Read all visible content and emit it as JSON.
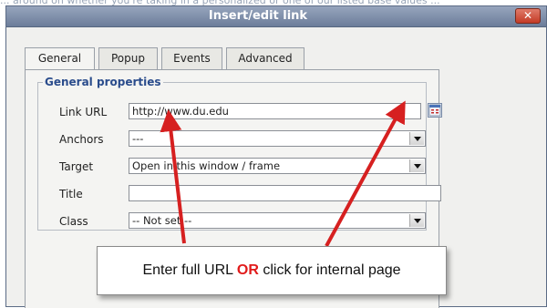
{
  "background": {
    "text": "... around on whether you're taking in a personalized or one of our listed base values ..."
  },
  "dialog": {
    "title": "Insert/edit link",
    "close_label": "✕",
    "tabs": [
      "General",
      "Popup",
      "Events",
      "Advanced"
    ],
    "active_tab": "General",
    "section_legend": "General properties",
    "fields": {
      "link_url": {
        "label": "Link URL",
        "value": "http://www.du.edu"
      },
      "anchors": {
        "label": "Anchors",
        "value": "---"
      },
      "target": {
        "label": "Target",
        "value": "Open in this window / frame"
      },
      "title": {
        "label": "Title",
        "value": ""
      },
      "class": {
        "label": "Class",
        "value": "-- Not set --"
      }
    }
  },
  "callout": {
    "text_before": "Enter full URL ",
    "text_or": "OR",
    "text_after": " click for internal page"
  },
  "colors": {
    "accent_red": "#d62020",
    "titlebar": "#7f8fa9",
    "legend": "#2a4c8c"
  },
  "icons": {
    "close": "close-icon",
    "browse": "browse-icon",
    "dropdown": "chevron-down-icon"
  }
}
